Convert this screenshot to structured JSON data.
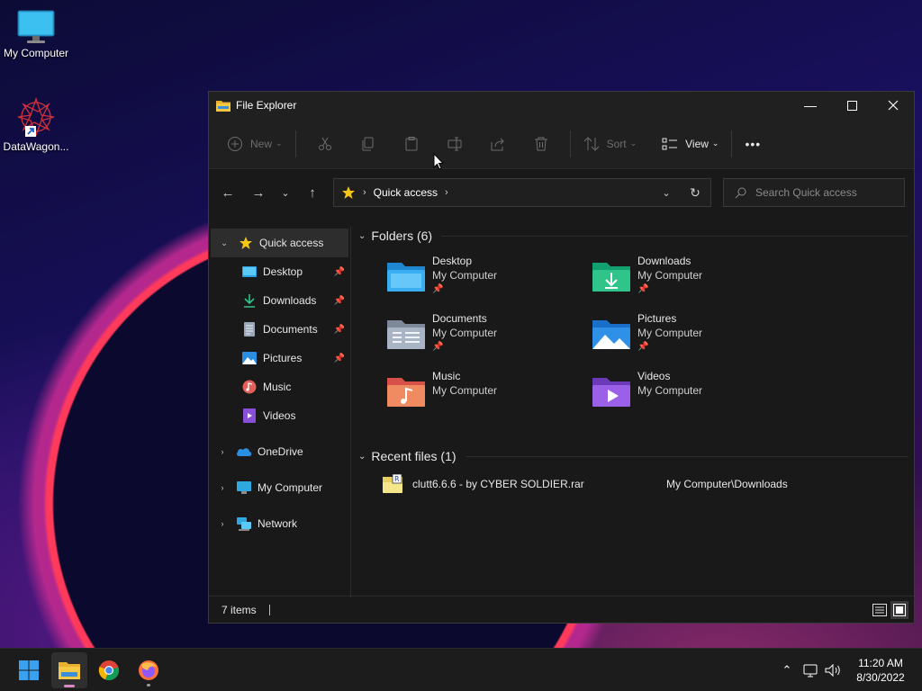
{
  "desktop": {
    "icons": [
      {
        "label": "My Computer",
        "icon": "monitor-icon"
      },
      {
        "label": "DataWagon...",
        "icon": "datawagon-shortcut-icon"
      }
    ]
  },
  "window": {
    "title": "File Explorer",
    "toolbar": {
      "new_label": "New",
      "sort_label": "Sort",
      "view_label": "View",
      "more_label": "•••"
    },
    "address": {
      "breadcrumb": "Quick access",
      "search_placeholder": "Search Quick access"
    },
    "sidebar": {
      "quick_access": "Quick access",
      "pinned": [
        {
          "label": "Desktop",
          "pinned": true
        },
        {
          "label": "Downloads",
          "pinned": true
        },
        {
          "label": "Documents",
          "pinned": true
        },
        {
          "label": "Pictures",
          "pinned": true
        },
        {
          "label": "Music",
          "pinned": false
        },
        {
          "label": "Videos",
          "pinned": false
        }
      ],
      "onedrive": "OneDrive",
      "my_computer": "My Computer",
      "network": "Network"
    },
    "main": {
      "folders_header": "Folders (6)",
      "folders": [
        {
          "name": "Desktop",
          "location": "My Computer",
          "pinned": true
        },
        {
          "name": "Downloads",
          "location": "My Computer",
          "pinned": true
        },
        {
          "name": "Documents",
          "location": "My Computer",
          "pinned": true
        },
        {
          "name": "Pictures",
          "location": "My Computer",
          "pinned": true
        },
        {
          "name": "Music",
          "location": "My Computer",
          "pinned": false
        },
        {
          "name": "Videos",
          "location": "My Computer",
          "pinned": false
        }
      ],
      "recent_header": "Recent files (1)",
      "recent": [
        {
          "name": "clutt6.6.6 - by CYBER SOLDIER.rar",
          "location": "My Computer\\Downloads"
        }
      ]
    },
    "status": {
      "items": "7 items"
    }
  },
  "taskbar": {
    "time": "11:20 AM",
    "date": "8/30/2022"
  },
  "colors": {
    "window_bg": "#191919",
    "toolbar_bg": "#202020",
    "selected_bg": "#2d2d2d",
    "star": "#f5c518"
  }
}
